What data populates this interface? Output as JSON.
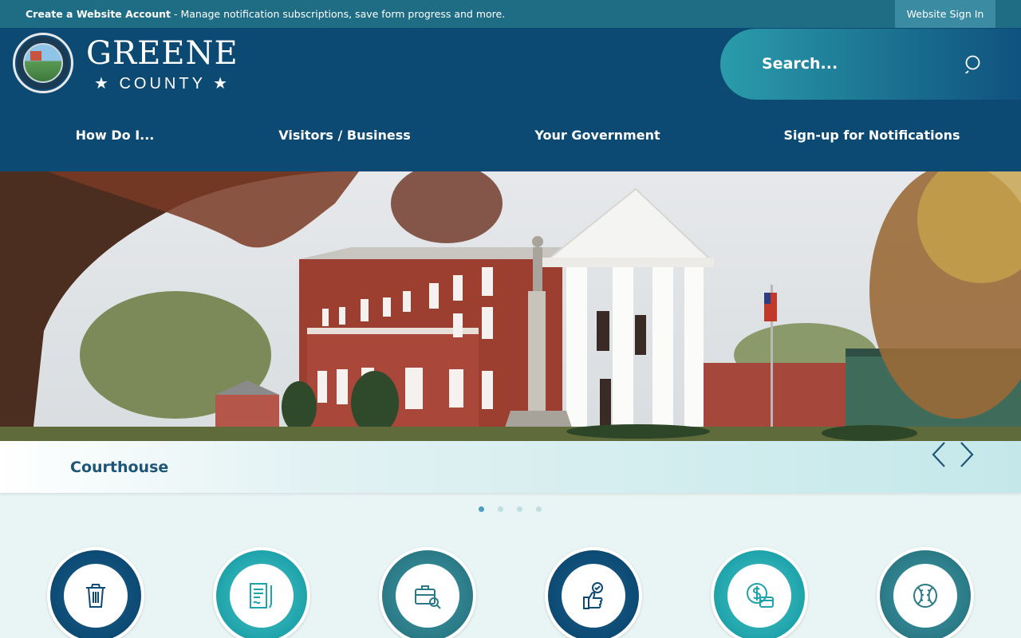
{
  "topbar": {
    "account_link": "Create a Website Account",
    "account_message": " - Manage notification subscriptions, save form progress and more.",
    "signin_label": "Website Sign In"
  },
  "header": {
    "logo_main": "GREENE",
    "logo_sub": "★ COUNTY ★",
    "search_placeholder": "Search..."
  },
  "nav": {
    "items": [
      "How Do I...",
      "Visitors / Business",
      "Your Government",
      "Sign-up for Notifications"
    ]
  },
  "hero": {
    "caption": "Courthouse",
    "slide_count": 4,
    "active_slide": 1
  },
  "quick_links": [
    {
      "icon": "trash-icon",
      "ring": "#0c4a73"
    },
    {
      "icon": "document-icon",
      "ring": "#1ea3ab"
    },
    {
      "icon": "briefcase-search-icon",
      "ring": "#2a7a86"
    },
    {
      "icon": "vote-hand-icon",
      "ring": "#0c4a73"
    },
    {
      "icon": "payment-icon",
      "ring": "#1ea3ab"
    },
    {
      "icon": "baseball-icon",
      "ring": "#2a7a86"
    }
  ],
  "colors": {
    "topbar": "#1f6d84",
    "header": "#0c4a73",
    "caption_text": "#1d5577",
    "accent_teal": "#1ea3ab"
  }
}
